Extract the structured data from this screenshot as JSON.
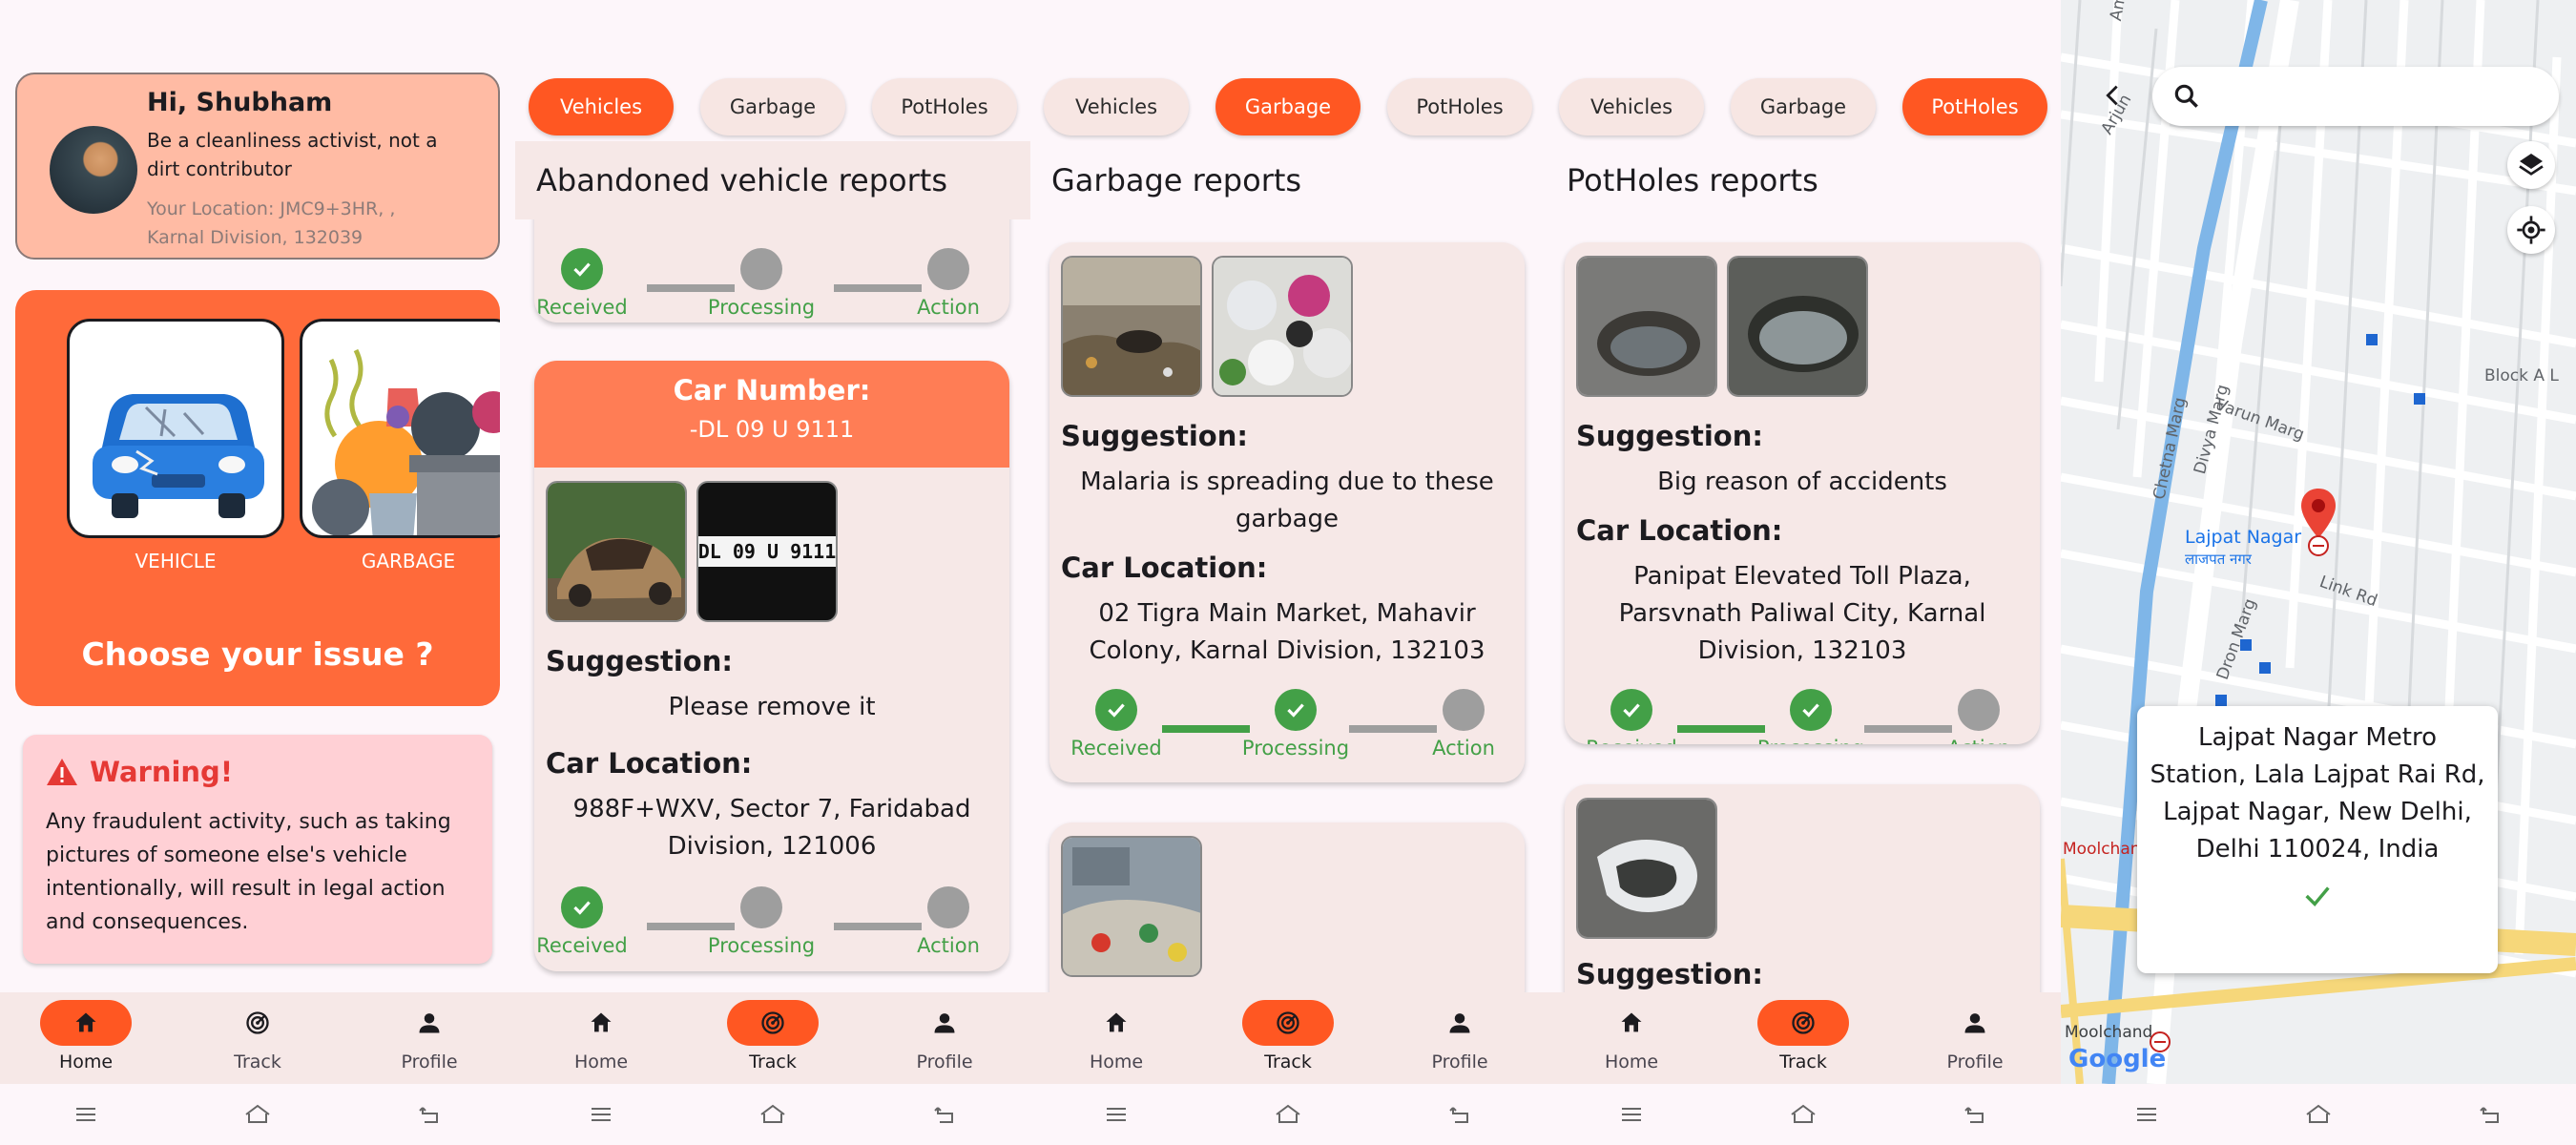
{
  "nav": {
    "home": "Home",
    "track": "Track",
    "profile": "Profile"
  },
  "colors": {
    "accent": "#ff5722",
    "success": "#43a047",
    "pending": "#9e9e9e",
    "warning": "#e53935"
  },
  "home": {
    "greeting": "Hi, Shubham",
    "quote": "Be a cleanliness activist, not a dirt contributor",
    "location": "Your Location: JMC9+3HR, , Karnal Division, 132039",
    "issues": [
      {
        "label": "VEHICLE",
        "icon": "car-icon"
      },
      {
        "label": "GARBAGE",
        "icon": "garbage-icon"
      }
    ],
    "choose": "Choose your issue ?",
    "warning_title": "Warning!",
    "warning_text": "Any fraudulent activity, such as taking pictures of someone else's vehicle intentionally, will result in legal action and consequences."
  },
  "tabs": [
    "Vehicles",
    "Garbage",
    "PotHoles"
  ],
  "status": {
    "received": "Received",
    "processing": "Processing",
    "action": "Action"
  },
  "labels": {
    "suggestion": "Suggestion:",
    "car_location": "Car Location:"
  },
  "vehicle": {
    "title": "Abandoned vehicle reports",
    "card_head": "Car Number:",
    "car_number": "-DL 09 U 9111",
    "plate_text": "DL 09 U 9111",
    "suggestion": "Please remove it",
    "location": "988F+WXV, Sector 7, Faridabad Division, 121006"
  },
  "garbage": {
    "title": "Garbage reports",
    "suggestion": "Malaria is spreading due to these garbage",
    "location": "02 Tigra Main Market, Mahavir Colony, Karnal Division, 132103"
  },
  "potholes": {
    "title": "PotHoles reports",
    "suggestion": "Big reason of accidents",
    "location": "Panipat Elevated Toll Plaza, Parsvnath Paliwal City, Karnal Division, 132103"
  },
  "map": {
    "search_placeholder": "",
    "place_label": "Lajpat Nagar",
    "place_label_hi": "लाजपत नगर",
    "address": "Lajpat Nagar Metro Station, Lala Lajpat Rai Rd, Lajpat Nagar, New Delhi, Delhi 110024, India",
    "roads": [
      "Varun Marg",
      "Divya Marg",
      "Chetna Marg",
      "Link Rd",
      "Dron Marg",
      "Block A L",
      "Moolchan",
      "Moolchand",
      "Amar Vihar",
      "Arjun"
    ],
    "attribution": "Google"
  }
}
